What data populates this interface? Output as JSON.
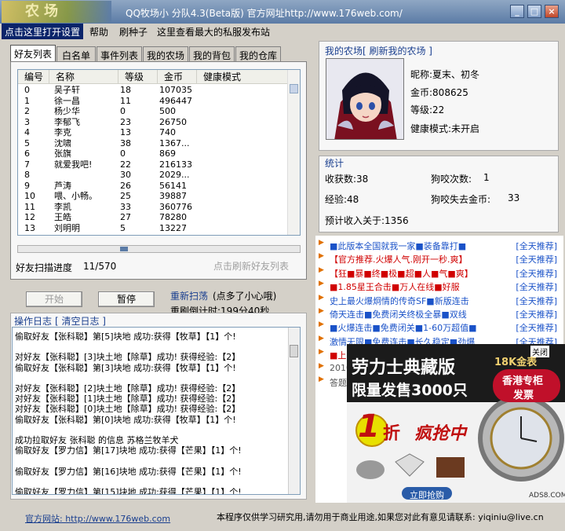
{
  "title": {
    "logo_text": "农场",
    "app_title": "QQ牧场小 分队4.3(Beta版) 官方网址http://www.176web.com/"
  },
  "menu": {
    "open_settings": "点击这里打开设置",
    "help": "帮助",
    "brush_seeds": "刷种子",
    "private_server": "这里查看最大的私服发布站"
  },
  "tabs": [
    "好友列表",
    "白名单",
    "事件列表",
    "我的农场",
    "我的背包",
    "我的仓库"
  ],
  "friends_table": {
    "columns": [
      "编号",
      "名称",
      "等级",
      "金币",
      "健康模式"
    ],
    "rows": [
      [
        "0",
        "吴子轩",
        "18",
        "107035",
        ""
      ],
      [
        "1",
        "徐一昌",
        "11",
        "496447",
        ""
      ],
      [
        "2",
        "杨少华",
        "0",
        "500",
        ""
      ],
      [
        "3",
        "李郁飞",
        "23",
        "26750",
        ""
      ],
      [
        "4",
        "李克",
        "13",
        "740",
        ""
      ],
      [
        "5",
        "沈啸",
        "38",
        "1367...",
        ""
      ],
      [
        "6",
        "张旗",
        "0",
        "869",
        ""
      ],
      [
        "7",
        "就爱我吧!",
        "22",
        "216133",
        ""
      ],
      [
        "8",
        "",
        "30",
        "2029...",
        ""
      ],
      [
        "9",
        "芦涛",
        "26",
        "56141",
        ""
      ],
      [
        "10",
        "喂、小畅。",
        "25",
        "39887",
        ""
      ],
      [
        "11",
        "李凯",
        "33",
        "360776",
        ""
      ],
      [
        "12",
        "王皓",
        "27",
        "78280",
        ""
      ],
      [
        "13",
        "刘明明",
        "5",
        "13227",
        ""
      ]
    ],
    "hscroll_position": 0.37
  },
  "scan": {
    "progress_label": "好友扫描进度",
    "progress_value": "11/570",
    "refresh_link": "点击刷新好友列表"
  },
  "controls": {
    "start": "开始",
    "pause": "暂停",
    "rescan": "重新扫荡",
    "rescan_note": "(点多了小心哦)",
    "countdown": "重刷倒计时:199分40秒"
  },
  "farm": {
    "title": "我的农场",
    "refresh": "[ 刷新我的农场 ]",
    "nickname": "昵称:夏末、初冬",
    "gold": "金币:808625",
    "level": "等级:22",
    "health": "健康模式:未开启"
  },
  "stats": {
    "title": "统计",
    "harvest": "收获数:38",
    "dog_bites": "狗咬次数:",
    "dog_bites_value": "1",
    "experience": "经验:48",
    "dog_loss": "狗咬失去金币:",
    "dog_loss_value": "33",
    "expected_income": "预计收入关于:1356"
  },
  "log": {
    "title": "操作日志",
    "clear": "[ 清空日志 ]",
    "lines": [
      "偷取好友【张科聪】第[5]块地 成功:获得【牧草】【1】个!",
      "",
      "对好友【张科聪】[3]块土地【除草】成功! 获得经验:【2】",
      "偷取好友【张科聪】第[3]块地 成功:获得【牧草】【1】个!",
      "",
      "对好友【张科聪】[2]块土地【除草】成功! 获得经验:【2】",
      "对好友【张科聪】[1]块土地【除草】成功! 获得经验:【2】",
      "对好友【张科聪】[0]块土地【除草】成功! 获得经验:【2】",
      "偷取好友【张科聪】第[0]块地 成功:获得【牧草】【1】个!",
      "",
      "成功拉取好友 张科聪 的信息 苏格兰牧羊犬",
      "偷取好友【罗力信】第[17]块地 成功:获得【芒果】【1】个!",
      "",
      "偷取好友【罗力信】第[16]块地 成功:获得【芒果】【1】个!",
      "",
      "偷取好友【罗力信】第[15]块地 成功:获得【芒果】【1】个!"
    ]
  },
  "ads": [
    {
      "text": "■此版本全国就我一家■装备靠打■",
      "tag": "[全天推荐]",
      "color": "#1a52c8"
    },
    {
      "text": "【官方推荐.火爆人气.刚开一秒.爽】",
      "tag": "[全天推荐]",
      "color": "#d00000"
    },
    {
      "text": "【狂■暴■终■极■超■人■气■爽】",
      "tag": "[全天推荐]",
      "color": "#d00000"
    },
    {
      "text": "■1.85星王合击■万人在线■好服",
      "tag": "[全天推荐]",
      "color": "#d00000"
    },
    {
      "text": "史上最火爆炯情的传奇SF■新版连击",
      "tag": "[全天推荐]",
      "color": "#1a52c8"
    },
    {
      "text": "倚天连击■免费闭关终极全暴■双线",
      "tag": "[全天推荐]",
      "color": "#1a52c8"
    },
    {
      "text": "■火爆连击■免费闭关■1-60万超值■",
      "tag": "[全天推荐]",
      "color": "#1a52c8"
    },
    {
      "text": "激情无限■免费连击■长久稳定■劲爆",
      "tag": "[全天推荐]",
      "color": "#1a52c8"
    },
    {
      "text": "■上",
      "tag": "",
      "color": "#d00000"
    },
    {
      "text": "2010",
      "tag": "",
      "color": "#555555"
    },
    {
      "text": "答题",
      "tag": "",
      "color": "#555555"
    }
  ],
  "banner": {
    "close": "关闭",
    "headline": "劳力士典藏版",
    "subline": "限量发售3000只",
    "gold_tag": "18K金表",
    "hk_tag_1": "香港专柜",
    "hk_tag_2": "发票",
    "discount_num": "1",
    "discount_char": "折",
    "discount_text": "疯抢中",
    "buy_button": "立即抢购",
    "watermark": "ADS8.COM"
  },
  "footer": {
    "official_site": "官方网站: http://www.176web.com",
    "disclaimer": "本程序仅供学习研究用,请勿用于商业用途,如果您对此有意见请联系: yiqiniu@live.cn"
  }
}
